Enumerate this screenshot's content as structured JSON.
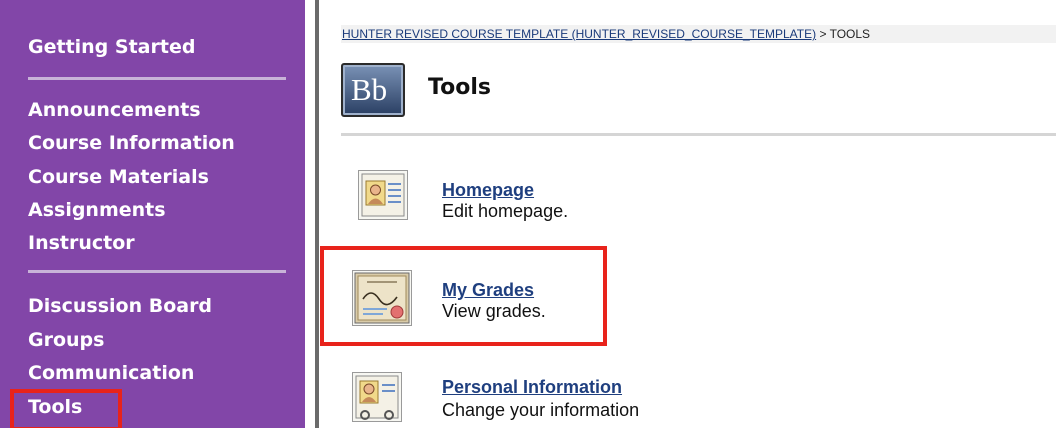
{
  "sidebar": {
    "items": [
      {
        "label": "Getting Started"
      },
      {
        "label": "Announcements"
      },
      {
        "label": "Course Information"
      },
      {
        "label": "Course Materials"
      },
      {
        "label": "Assignments"
      },
      {
        "label": "Instructor"
      },
      {
        "label": "Discussion Board"
      },
      {
        "label": "Groups"
      },
      {
        "label": "Communication"
      },
      {
        "label": "Tools"
      }
    ],
    "background": "#8246a8",
    "highlight_color": "#e8231b",
    "highlighted_item": "Tools"
  },
  "breadcrumb": {
    "course_link": "HUNTER REVISED COURSE TEMPLATE (HUNTER_REVISED_COURSE_TEMPLATE)",
    "separator": ">",
    "current": "TOOLS"
  },
  "header": {
    "logo_text": "Bb",
    "title": "Tools"
  },
  "tools": [
    {
      "name": "Homepage",
      "description": "Edit homepage.",
      "icon": "homepage-icon"
    },
    {
      "name": "My Grades",
      "description": "View grades.",
      "icon": "certificate-icon",
      "highlighted": true
    },
    {
      "name": "Personal Information",
      "description": "Change your information",
      "icon": "id-card-icon"
    }
  ]
}
